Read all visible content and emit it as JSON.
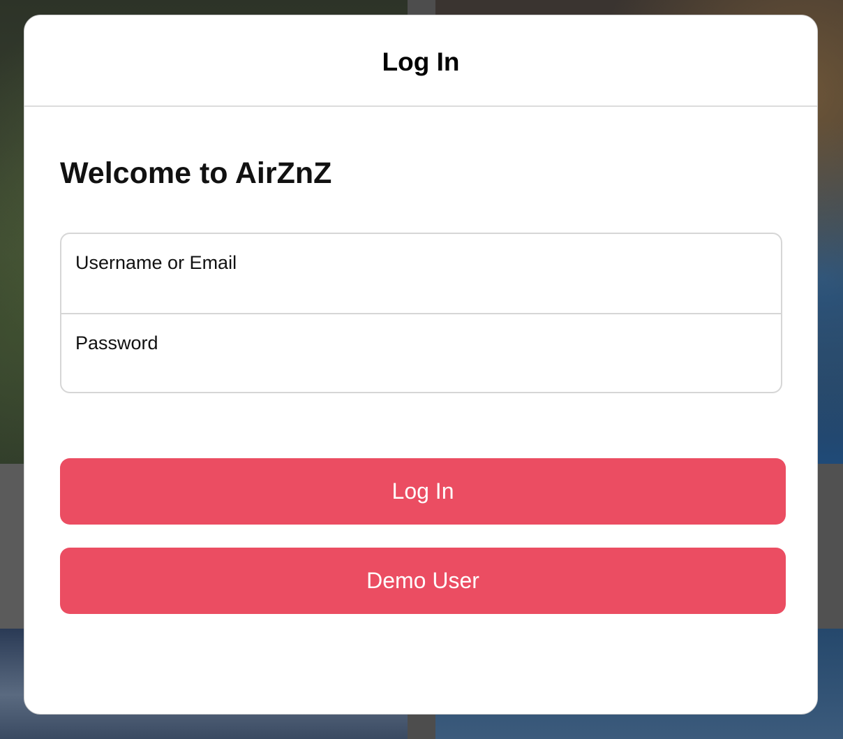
{
  "modal": {
    "title": "Log In",
    "welcome": "Welcome to AirZnZ"
  },
  "form": {
    "username_label": "Username or Email",
    "username_value": "",
    "password_label": "Password",
    "password_value": ""
  },
  "buttons": {
    "login_label": "Log In",
    "demo_label": "Demo User"
  },
  "colors": {
    "accent": "#eb4d62",
    "border": "#d6d6d6"
  }
}
